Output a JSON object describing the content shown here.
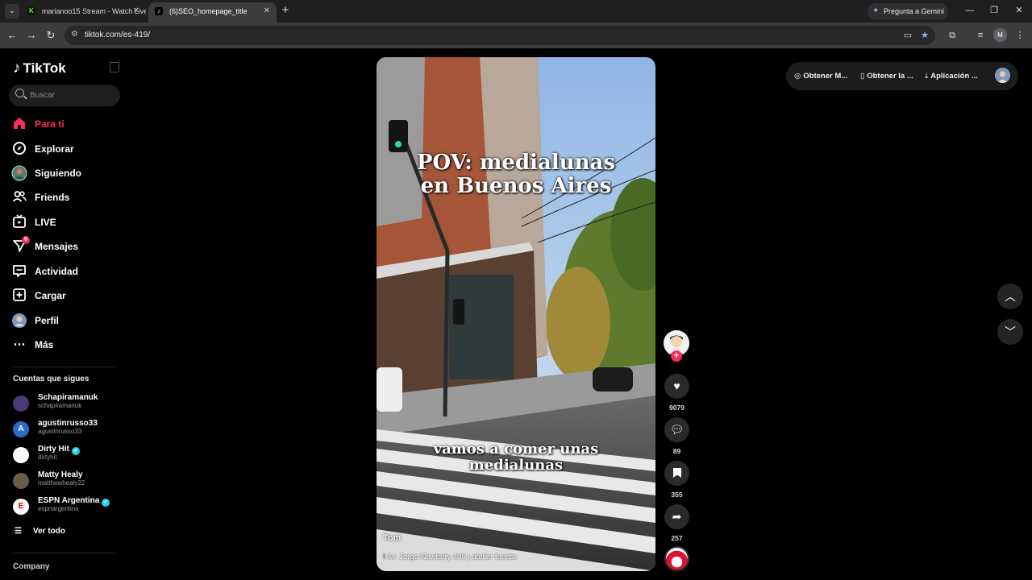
{
  "browser": {
    "tabs": [
      {
        "favicon": "K",
        "title": "marianoo15 Stream - Watch Live",
        "close": "✕"
      },
      {
        "favicon": "♪",
        "title": "(6)SEO_homepage_title",
        "close": "✕"
      }
    ],
    "new_tab": "+",
    "gemini_label": "Pregunta a Gemini",
    "url": "tiktok.com/es-419/",
    "profile_initial": "M"
  },
  "sidebar": {
    "logo": "TikTok",
    "search_placeholder": "Buscar",
    "nav": [
      {
        "label": "Para ti",
        "icon": "home-icon"
      },
      {
        "label": "Explorar",
        "icon": "compass-icon"
      },
      {
        "label": "Siguiendo",
        "icon": "following-avatar-icon"
      },
      {
        "label": "Friends",
        "icon": "friends-icon"
      },
      {
        "label": "LIVE",
        "icon": "live-icon"
      },
      {
        "label": "Mensajes",
        "icon": "messages-icon",
        "badge": "6"
      },
      {
        "label": "Actividad",
        "icon": "activity-icon"
      },
      {
        "label": "Cargar",
        "icon": "upload-icon"
      },
      {
        "label": "Perfil",
        "icon": "profile-avatar-icon"
      },
      {
        "label": "Más",
        "icon": "more-icon"
      }
    ],
    "following_title": "Cuentas que sigues",
    "following": [
      {
        "name": "Schapiramanuk",
        "handle": "schapiramanuk",
        "verified": false
      },
      {
        "name": "agustinrusso33",
        "handle": "agustinrusso33",
        "verified": false
      },
      {
        "name": "Dirty Hit",
        "handle": "dirtyhit",
        "verified": true
      },
      {
        "name": "Matty Healy",
        "handle": "matthewhealy22",
        "verified": false
      },
      {
        "name": "ESPN Argentina",
        "handle": "espnargentina",
        "verified": true
      }
    ],
    "see_all": "Ver todo",
    "company": "Company"
  },
  "video": {
    "title_line1": "POV: medialunas",
    "title_line2": "en Buenos Aires",
    "subtitle_line1": "vamos a comer unas",
    "subtitle_line2": "medialunas",
    "author": "Tom",
    "location": "Av. Jorge Newbery 405 | atelier fuerza"
  },
  "actions": {
    "likes": "9079",
    "comments": "89",
    "saves": "355",
    "shares": "257"
  },
  "header": {
    "actions": [
      {
        "label": "Obtener M...",
        "icon": "coin-icon"
      },
      {
        "label": "Obtener la ...",
        "icon": "phone-icon"
      },
      {
        "label": "Aplicación ...",
        "icon": "download-icon"
      }
    ]
  },
  "colors": {
    "accent": "#fe2c55",
    "background": "#000000",
    "verified": "#20d5ec"
  }
}
